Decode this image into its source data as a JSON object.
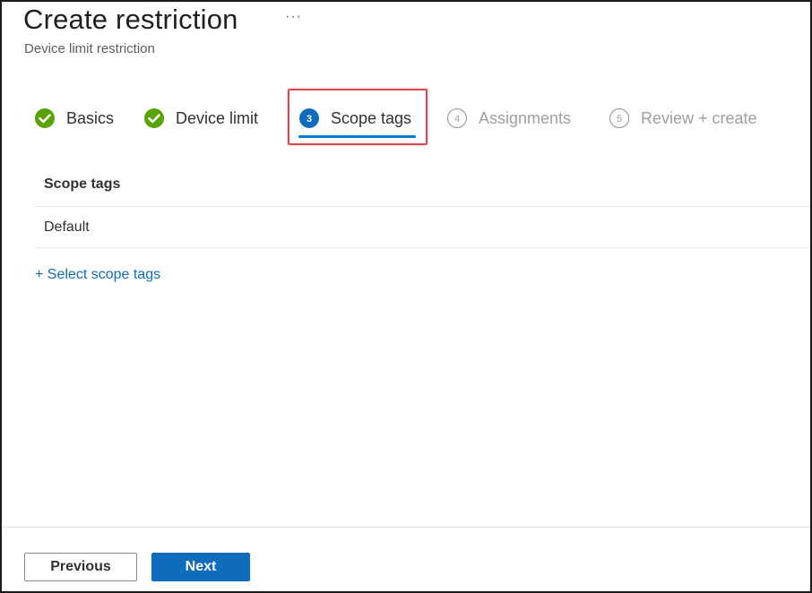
{
  "header": {
    "title": "Create restriction",
    "more_label": "···",
    "subtitle": "Device limit restriction"
  },
  "steps": [
    {
      "number": "",
      "label": "Basics",
      "state": "done",
      "icon": "check-circle-icon"
    },
    {
      "number": "",
      "label": "Device limit",
      "state": "done",
      "icon": "check-circle-icon"
    },
    {
      "number": "3",
      "label": "Scope tags",
      "state": "current",
      "icon": "step-number-icon"
    },
    {
      "number": "4",
      "label": "Assignments",
      "state": "future",
      "icon": "step-number-icon"
    },
    {
      "number": "5",
      "label": "Review + create",
      "state": "future",
      "icon": "step-number-icon"
    }
  ],
  "scope_table": {
    "header": "Scope tags",
    "rows": [
      "Default"
    ]
  },
  "select_scope_tags_label": "+ Select scope tags",
  "footer": {
    "previous_label": "Previous",
    "next_label": "Next"
  },
  "colors": {
    "accent": "#0f6cbd",
    "success": "#57a300",
    "highlight": "#e0474c",
    "muted": "#a19f9d"
  }
}
